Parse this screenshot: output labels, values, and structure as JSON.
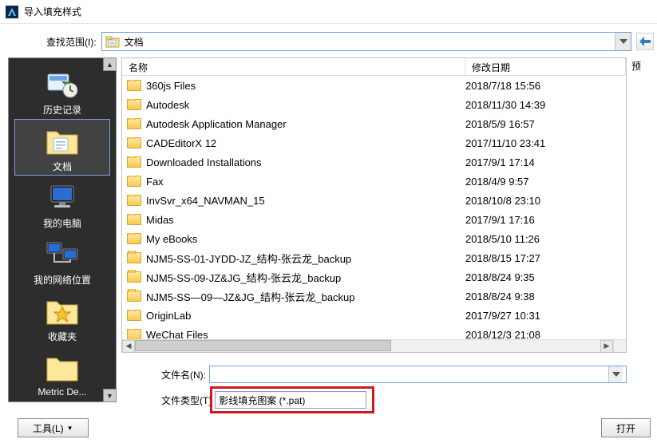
{
  "title": "导入填充样式",
  "lookin": {
    "label": "查找范围(I):",
    "value": "文档"
  },
  "preview_label": "预",
  "sidebar": {
    "items": [
      {
        "label": "历史记录",
        "icon": "history"
      },
      {
        "label": "文档",
        "icon": "folder-doc",
        "selected": true
      },
      {
        "label": "我的电脑",
        "icon": "computer"
      },
      {
        "label": "我的网络位置",
        "icon": "network"
      },
      {
        "label": "收藏夹",
        "icon": "favorites"
      },
      {
        "label": "Metric De...",
        "icon": "folder-plain",
        "cut": true
      }
    ]
  },
  "columns": {
    "name": "名称",
    "date": "修改日期"
  },
  "files": [
    {
      "name": "360js Files",
      "date": "2018/7/18 15:56"
    },
    {
      "name": "Autodesk",
      "date": "2018/11/30 14:39"
    },
    {
      "name": "Autodesk Application Manager",
      "date": "2018/5/9 16:57"
    },
    {
      "name": "CADEditorX 12",
      "date": "2017/11/10 23:41"
    },
    {
      "name": "Downloaded Installations",
      "date": "2017/9/1 17:14"
    },
    {
      "name": "Fax",
      "date": "2018/4/9 9:57"
    },
    {
      "name": "InvSvr_x64_NAVMAN_15",
      "date": "2018/10/8 23:10"
    },
    {
      "name": "Midas",
      "date": "2017/9/1 17:16"
    },
    {
      "name": "My eBooks",
      "date": "2018/5/10 11:26"
    },
    {
      "name": "NJM5-SS-01-JYDD-JZ_结构-张云龙_backup",
      "date": "2018/8/15 17:27"
    },
    {
      "name": "NJM5-SS-09-JZ&JG_结构-张云龙_backup",
      "date": "2018/8/24 9:35"
    },
    {
      "name": "NJM5-SS—09—JZ&JG_结构-张云龙_backup",
      "date": "2018/8/24 9:38"
    },
    {
      "name": "OriginLab",
      "date": "2017/9/27 10:31"
    },
    {
      "name": "WeChat Files",
      "date": "2018/12/3 21:08"
    }
  ],
  "filename": {
    "label": "文件名(N):",
    "value": ""
  },
  "filetype": {
    "label": "文件类型(T)",
    "value": "影线填充图案 (*.pat)"
  },
  "buttons": {
    "tools": "工具(L)",
    "open": "打开"
  }
}
